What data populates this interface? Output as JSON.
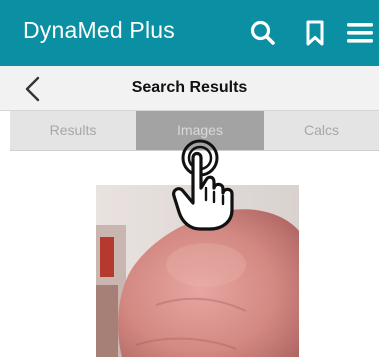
{
  "app": {
    "title": "DynaMed Plus"
  },
  "header": {
    "icons": [
      "search-icon",
      "bookmark-icon",
      "menu-icon"
    ],
    "background": "#0b8fa3"
  },
  "subheader": {
    "back_icon": "chevron-left-icon",
    "title": "Search Results"
  },
  "tabs": {
    "items": [
      {
        "label": "Results",
        "selected": false
      },
      {
        "label": "Images",
        "selected": true
      },
      {
        "label": "Calcs",
        "selected": false
      }
    ],
    "selected_background": "#a3a3a3"
  },
  "content": {
    "image_subject": "clinical photograph of skin (abdomen/flank)"
  },
  "overlay": {
    "icon": "tap-gesture-hand-icon",
    "target": "Images"
  }
}
